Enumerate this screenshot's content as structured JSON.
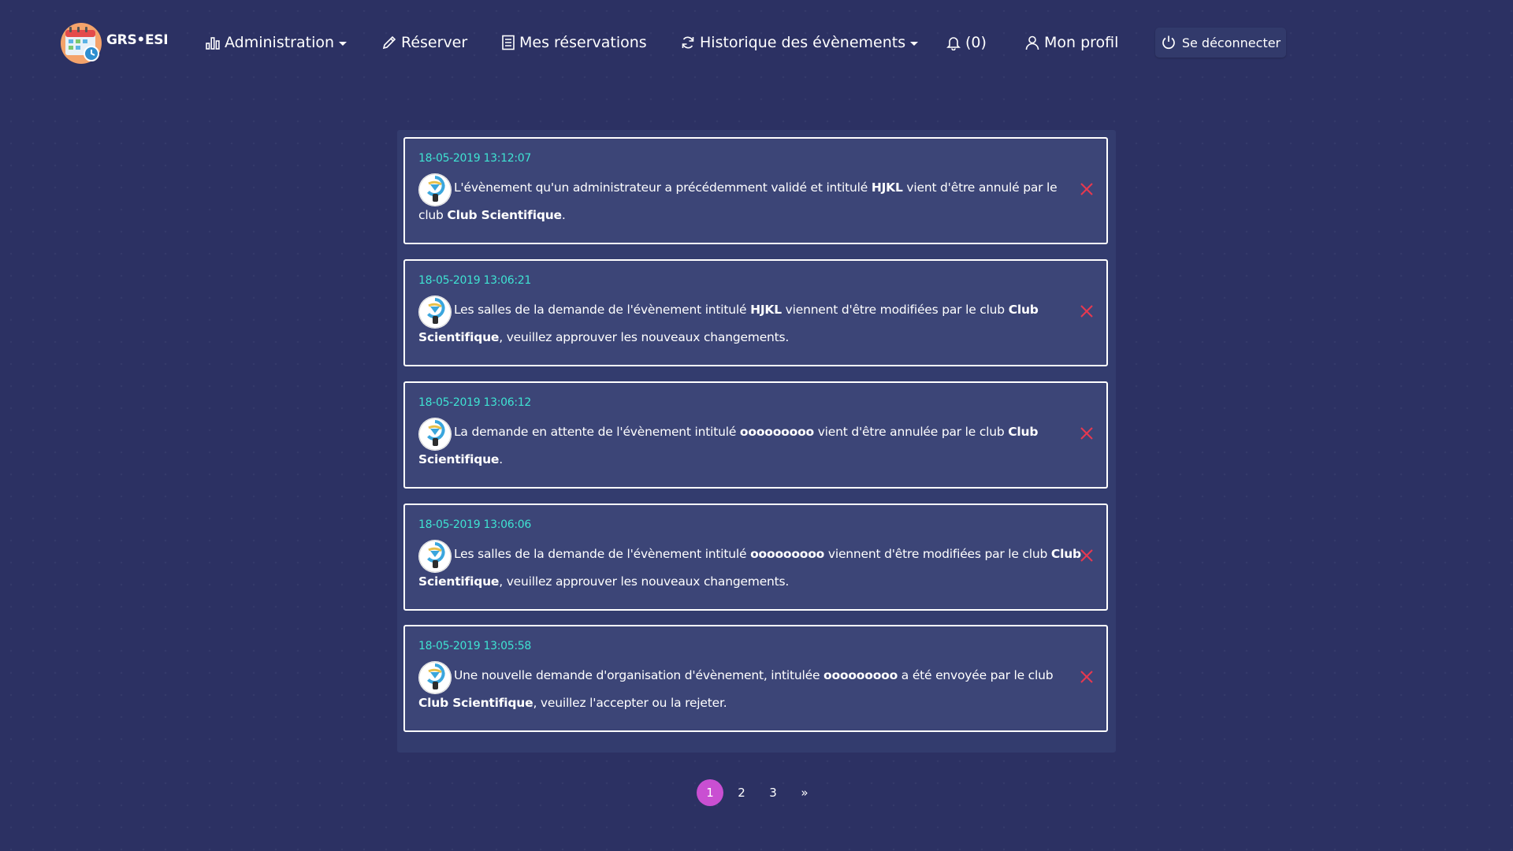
{
  "brand": {
    "name": "GRS•ESI",
    "logo_icon": "calendar-logo-icon"
  },
  "nav": {
    "administration": "Administration",
    "reserver": "Réserver",
    "mes_reservations": "Mes réservations",
    "historique": "Historique des évènements",
    "notifications": "(0)",
    "profil": "Mon profil",
    "logout": "Se déconnecter"
  },
  "colors": {
    "background": "#2c3163",
    "panel": "#333c6e",
    "date": "#3fe3d2",
    "close": "#e8384f",
    "active_page": "#c94fd2"
  },
  "notifications": [
    {
      "date": "18-05-2019 13:12:07",
      "t1": "L'évènement qu'un administrateur a précédemment validé et intitulé ",
      "b1": "HJKL",
      "t2": " vient d'être annulé par le club ",
      "b2": "Club Scientifique",
      "t3": "."
    },
    {
      "date": "18-05-2019 13:06:21",
      "t1": "Les salles de la demande de l'évènement intitulé ",
      "b1": "HJKL",
      "t2": " viennent d'être modifiées par le club ",
      "b2": "Club Scientifique",
      "t3": ", veuillez approuver les nouveaux changements."
    },
    {
      "date": "18-05-2019 13:06:12",
      "t1": "La demande en attente de l'évènement intitulé ",
      "b1": "ooooooooo",
      "t2": " vient d'être annulée par le club ",
      "b2": "Club Scientifique",
      "t3": "."
    },
    {
      "date": "18-05-2019 13:06:06",
      "t1": "Les salles de la demande de l'évènement intitulé ",
      "b1": "ooooooooo",
      "t2": " viennent d'être modifiées par le club ",
      "b2": "Club Scientifique",
      "t3": ", veuillez approuver les nouveaux changements."
    },
    {
      "date": "18-05-2019 13:05:58",
      "t1": "Une nouvelle demande d'organisation d'évènement, intitulée ",
      "b1": "ooooooooo",
      "t2": " a été envoyée par le club ",
      "b2": "Club Scientifique",
      "t3": ", veuillez l'accepter ou la rejeter."
    }
  ],
  "pagination": {
    "pages": [
      "1",
      "2",
      "3"
    ],
    "next": "»",
    "active": "1"
  }
}
